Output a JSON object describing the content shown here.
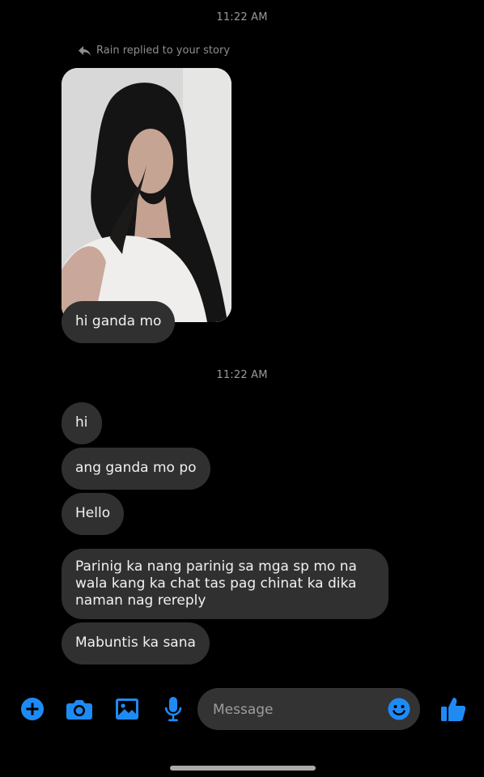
{
  "conversation": {
    "timestamp_1": "11:22 AM",
    "reply_note": "Rain replied to your story",
    "timestamp_2": "11:22 AM",
    "messages": [
      "hi ganda mo",
      "hi",
      "ang ganda mo po",
      "Hello",
      "Parinig ka nang parinig sa mga sp mo na wala kang ka chat tas pag chinat ka dika naman nag rereply",
      "Mabuntis ka sana"
    ]
  },
  "composer": {
    "placeholder": "Message",
    "icons": [
      "plus-icon",
      "camera-icon",
      "image-icon",
      "microphone-icon",
      "emoji-icon",
      "thumbs-up-icon"
    ]
  },
  "colors": {
    "background": "#000000",
    "bubble": "#303030",
    "accent": "#1e8bf5",
    "muted_text": "#9a9a9a"
  }
}
